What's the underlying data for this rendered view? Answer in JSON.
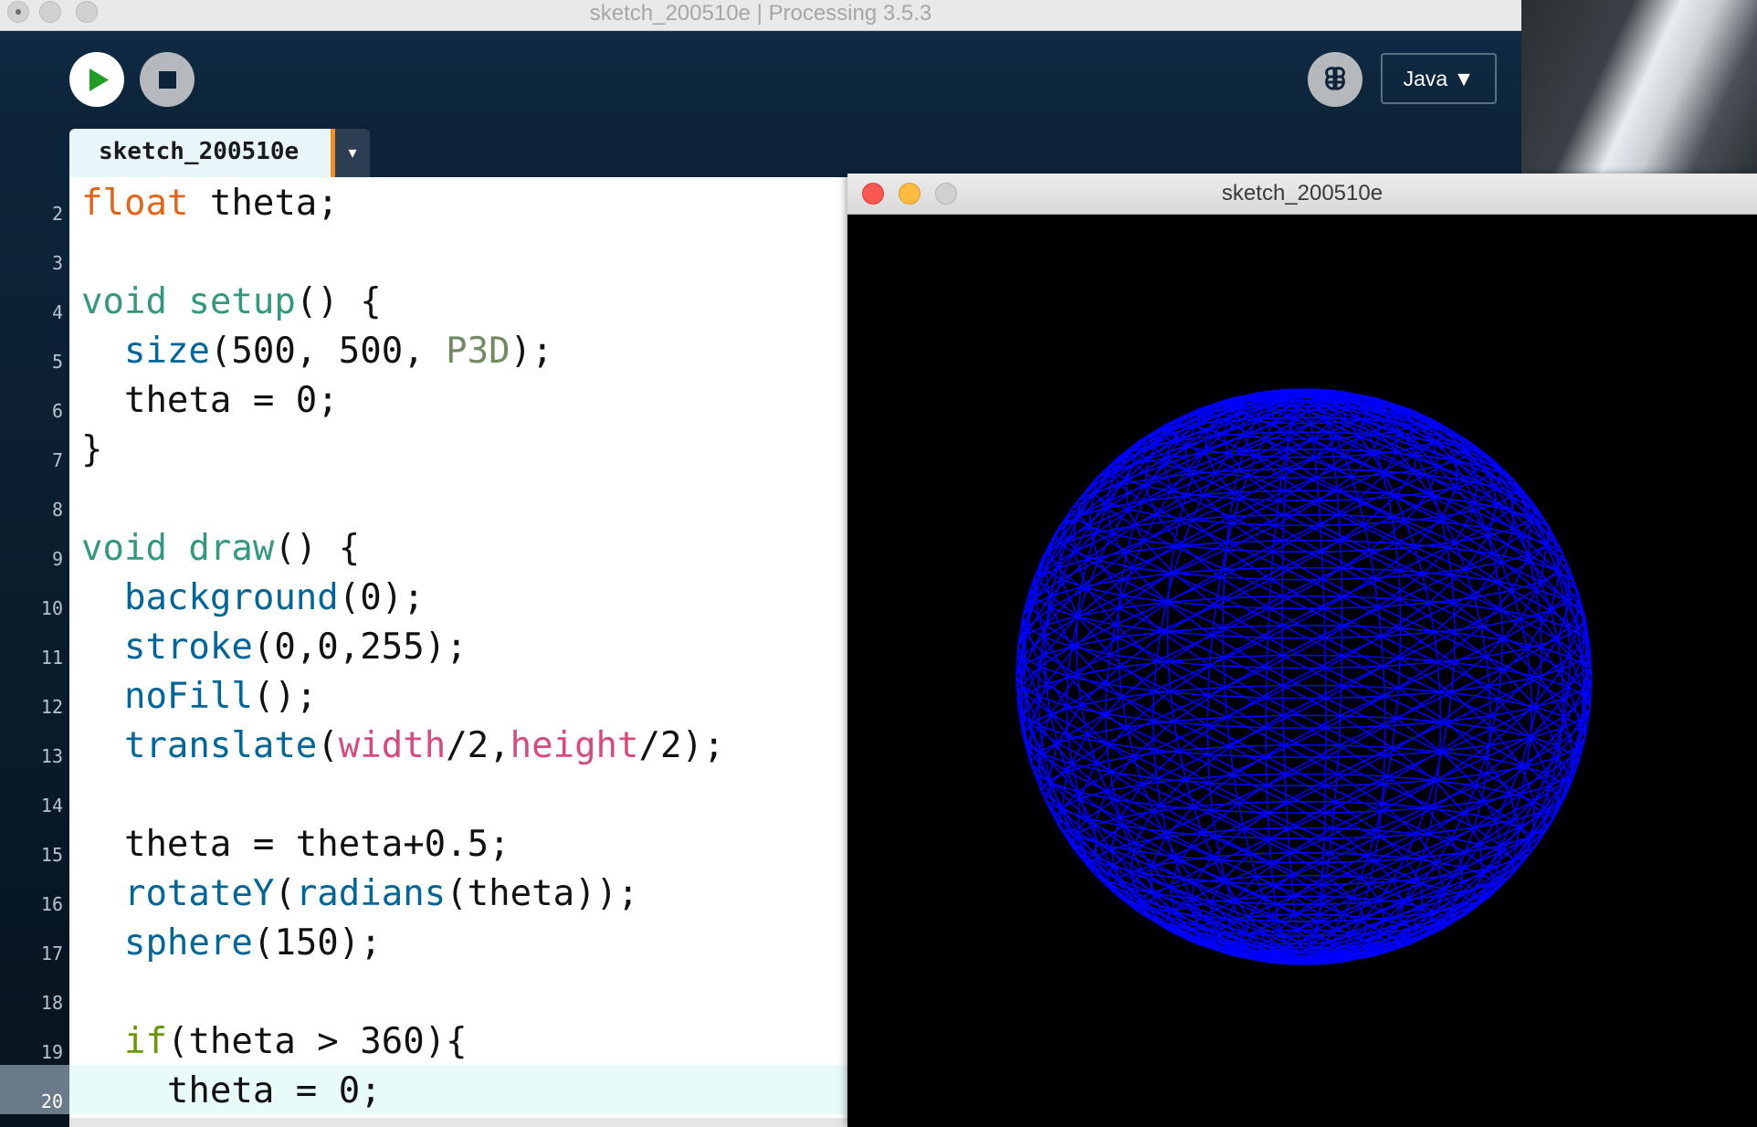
{
  "main_window": {
    "title": "sketch_200510e | Processing 3.5.3",
    "toolbar": {
      "run_icon": "play-icon",
      "stop_icon": "stop-icon",
      "debug_icon": "debugger-butterfly-icon",
      "mode_label": "Java ▼"
    },
    "tabs": [
      {
        "label": "sketch_200510e",
        "menu_glyph": "▾"
      }
    ],
    "editor": {
      "current_line": 20,
      "lines": [
        {
          "n": "2",
          "code": "float theta;"
        },
        {
          "n": "3",
          "code": ""
        },
        {
          "n": "4",
          "code": "void setup() {"
        },
        {
          "n": "5",
          "code": "  size(500, 500, P3D);"
        },
        {
          "n": "6",
          "code": "  theta = 0;"
        },
        {
          "n": "7",
          "code": "}"
        },
        {
          "n": "8",
          "code": ""
        },
        {
          "n": "9",
          "code": "void draw() {"
        },
        {
          "n": "10",
          "code": "  background(0);"
        },
        {
          "n": "11",
          "code": "  stroke(0,0,255);"
        },
        {
          "n": "12",
          "code": "  noFill();"
        },
        {
          "n": "13",
          "code": "  translate(width/2,height/2);"
        },
        {
          "n": "14",
          "code": ""
        },
        {
          "n": "15",
          "code": "  theta = theta+0.5;"
        },
        {
          "n": "16",
          "code": "  rotateY(radians(theta));"
        },
        {
          "n": "17",
          "code": "  sphere(150);"
        },
        {
          "n": "18",
          "code": ""
        },
        {
          "n": "19",
          "code": "  if(theta > 360){"
        },
        {
          "n": "20",
          "code": "    theta = 0;"
        }
      ]
    }
  },
  "sketch_window": {
    "title": "sketch_200510e",
    "background_color": "#000000",
    "stroke_color": "#0000ff"
  },
  "colors": {
    "toolbar_bg": "#0d2438",
    "editor_bg": "#ffffff",
    "current_line_bg": "#e8fbf8",
    "type_keyword": "#e2661a",
    "structure_keyword": "#33997e",
    "function": "#006699",
    "constant": "#718a62",
    "builtin_var": "#d94a7a",
    "control": "#669900"
  }
}
